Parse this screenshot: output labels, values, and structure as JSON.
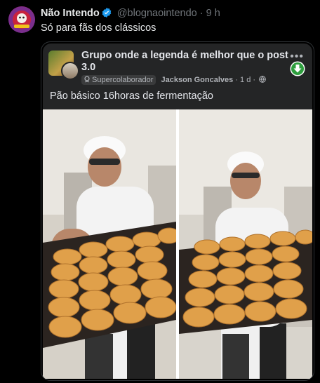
{
  "tweet": {
    "display_name": "Não Intendo",
    "handle": "@blognaointendo",
    "separator": "·",
    "time": "9 h",
    "text": "Só para fãs dos clássicos"
  },
  "quoted_post": {
    "group_title": "Grupo onde a legenda é melhor que o post 3.0",
    "more_label": "•••",
    "badge_label": "Supercolaborador",
    "author": "Jackson Goncalves",
    "meta_separator": "·",
    "post_time": "1 d",
    "meta_separator_2": "·",
    "caption": "Pão básico 16horas de fermentação"
  },
  "colors": {
    "background": "#000000",
    "card": "#242526",
    "accent_verified": "#1d9bf0",
    "download_green": "#2e9e3e"
  },
  "icons": [
    "verified-badge-icon",
    "more-options-icon",
    "download-icon",
    "supercolaborador-badge-icon",
    "globe-icon"
  ]
}
